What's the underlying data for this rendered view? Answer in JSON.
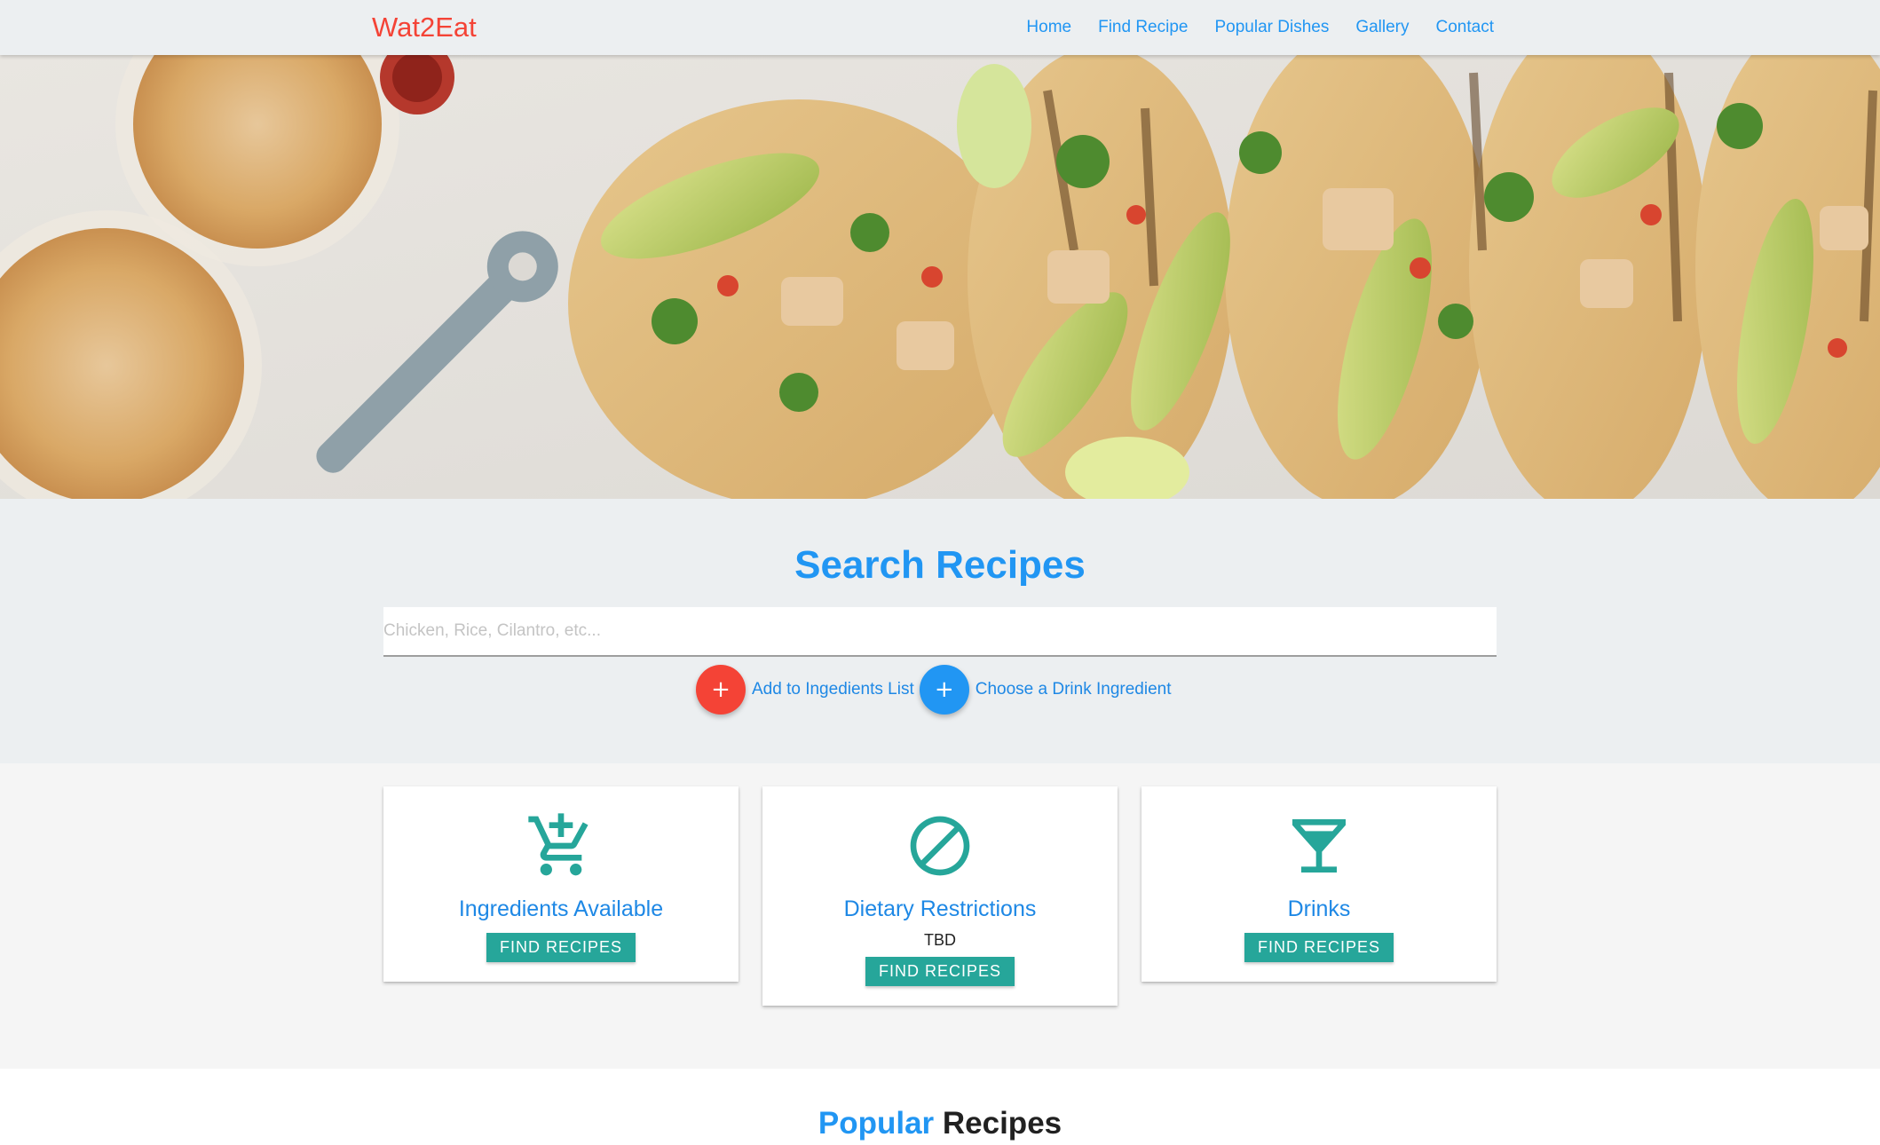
{
  "nav": {
    "brand": "Wat2Eat",
    "links": [
      "Home",
      "Find Recipe",
      "Popular Dishes",
      "Gallery",
      "Contact"
    ]
  },
  "hero": {
    "image": "tacos-and-beer-photo"
  },
  "search": {
    "title": "Search Recipes",
    "placeholder": "Chicken, Rice, Cilantro, etc...",
    "add_ingredient_label": "Add to Ingedients List",
    "add_drink_label": "Choose a Drink Ingredient",
    "fab_symbol": "+"
  },
  "cards": [
    {
      "icon": "cart-plus-icon",
      "title": "Ingredients Available",
      "note": "",
      "button": "FIND RECIPES"
    },
    {
      "icon": "block-icon",
      "title": "Dietary Restrictions",
      "note": "TBD",
      "button": "FIND RECIPES"
    },
    {
      "icon": "cocktail-icon",
      "title": "Drinks",
      "note": "",
      "button": "FIND RECIPES"
    }
  ],
  "popular": {
    "accent": "Popular",
    "rest": " Recipes"
  },
  "colors": {
    "brand": "#f44336",
    "link": "#2196f3",
    "teal": "#26a69a",
    "section_bg": "#eceff1"
  }
}
